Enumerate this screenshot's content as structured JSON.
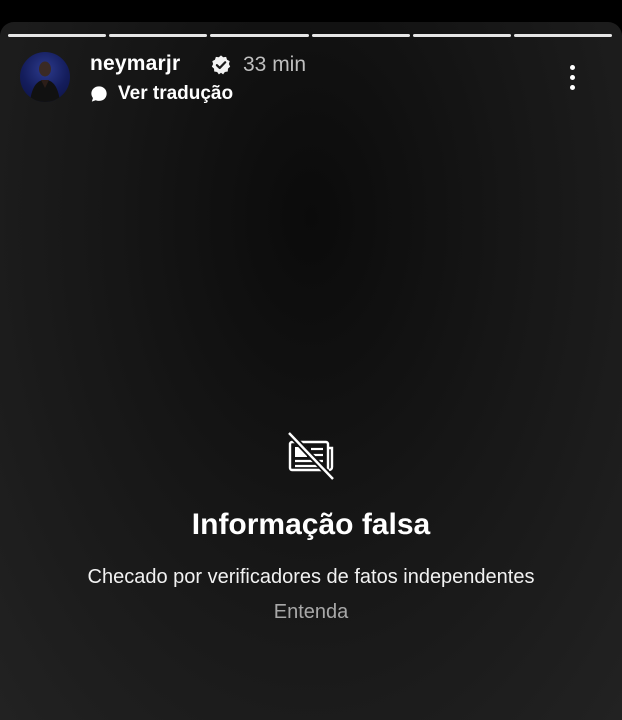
{
  "story": {
    "progress_segments": 6,
    "completed_segments": 6
  },
  "header": {
    "username": "neymarjr",
    "time": "33 min",
    "translate_label": "Ver tradução",
    "verified": true
  },
  "notice": {
    "title": "Informação falsa",
    "subtitle": "Checado por verificadores de fatos independentes",
    "link": "Entenda"
  },
  "icons": {
    "verified": "verified-badge-icon",
    "translate": "speech-bubble-icon",
    "more": "more-vertical-icon",
    "false_info": "news-crossed-icon"
  }
}
